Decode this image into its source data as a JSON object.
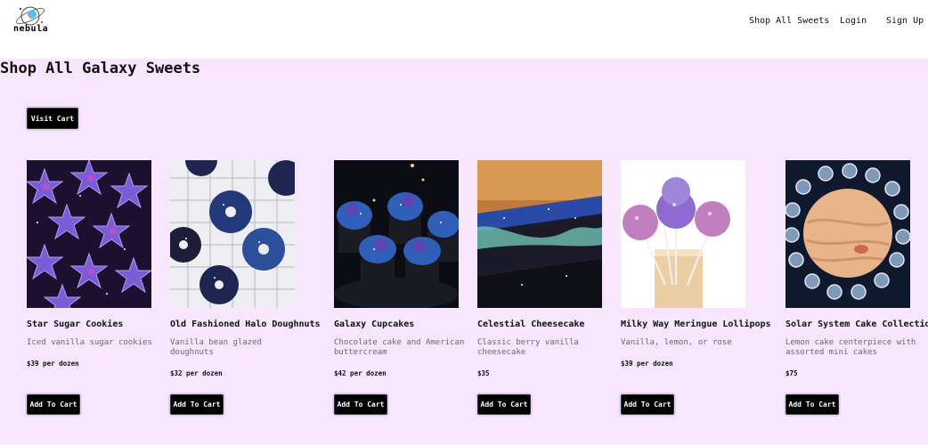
{
  "header": {
    "brand": "nebula",
    "nav": [
      "Shop All Sweets",
      "Login",
      "Sign Up"
    ]
  },
  "page": {
    "title": "Shop All Galaxy Sweets",
    "visit_cart_label": "Visit Cart"
  },
  "products": [
    {
      "name": "Star Sugar Cookies",
      "description": "Iced vanilla sugar cookies",
      "price": "$39 per dozen",
      "button": "Add To Cart"
    },
    {
      "name": "Old Fashioned Halo Doughnuts",
      "description": "Vanilla bean glazed doughnuts",
      "price": "$32 per dozen",
      "button": "Add To Cart"
    },
    {
      "name": "Galaxy Cupcakes",
      "description": "Chocolate cake and American buttercream",
      "price": "$42 per dozen",
      "button": "Add To Cart"
    },
    {
      "name": "Celestial Cheesecake",
      "description": "Classic berry vanilla cheesecake",
      "price": "$35",
      "button": "Add To Cart"
    },
    {
      "name": "Milky Way Meringue Lollipops",
      "description": "Vanilla, lemon, or rose",
      "price": "$39 per dozen",
      "button": "Add To Cart"
    },
    {
      "name": "Solar System Cake Collection",
      "description": "Lemon cake centerpiece with assorted mini cakes",
      "price": "$75",
      "button": "Add To Cart"
    }
  ],
  "colors": {
    "accent": "#000000",
    "page_bg": "#f7e6fd"
  }
}
